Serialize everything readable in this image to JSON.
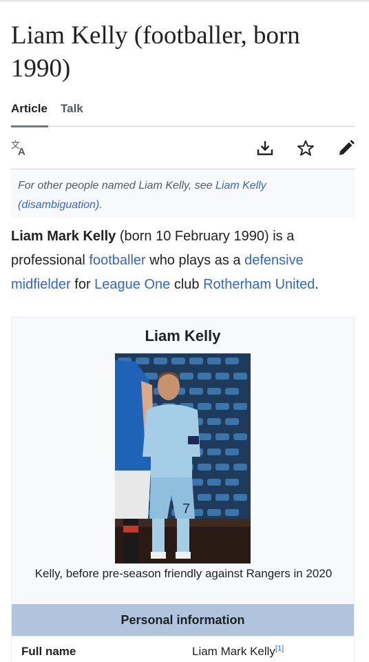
{
  "page": {
    "title": "Liam Kelly (footballer, born 1990)"
  },
  "tabs": [
    {
      "label": "Article",
      "active": true
    },
    {
      "label": "Talk",
      "active": false
    }
  ],
  "toolbar": {
    "icons": [
      "language-icon",
      "download-icon",
      "star-icon",
      "edit-icon"
    ]
  },
  "hatnote": {
    "prefix": "For other people named Liam Kelly, see ",
    "link": "Liam Kelly (disambiguation)",
    "suffix": "."
  },
  "lead": {
    "name": "Liam Mark Kelly",
    "t1": " (born 10 February 1990) is a professional ",
    "l1": "footballer",
    "t2": " who plays as a ",
    "l2": "defensive midfielder",
    "t3": " for ",
    "l3": "League One",
    "t4": " club ",
    "l4": "Rotherham United",
    "t5": "."
  },
  "infobox": {
    "title": "Liam Kelly",
    "caption": "Kelly, before pre-season friendly against Rangers in 2020",
    "section_header": "Personal information",
    "rows": [
      {
        "label": "Full name",
        "value": "Liam Mark Kelly",
        "ref": "[1]"
      }
    ]
  },
  "colors": {
    "link": "#3366cc",
    "infobox_header": "#b0c4de",
    "kit_sky_blue": "#a6cde6",
    "seats_blue": "#2e6a9e"
  }
}
